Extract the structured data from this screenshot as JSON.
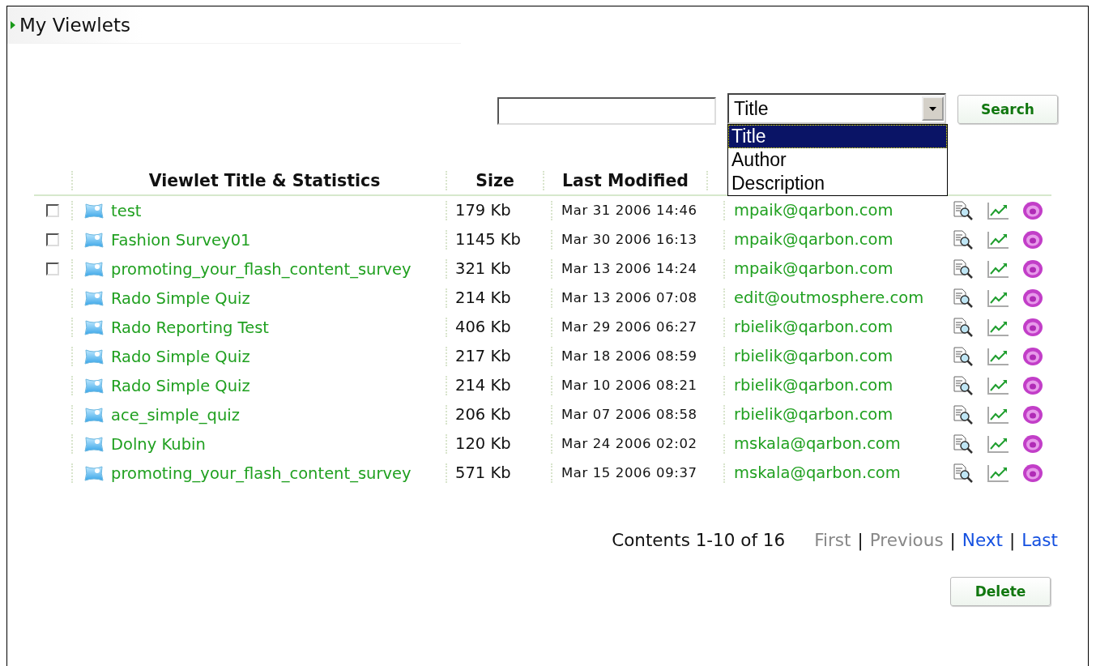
{
  "header": {
    "title": "My Viewlets"
  },
  "search": {
    "field": {
      "value": "Title",
      "open": true,
      "options": [
        {
          "label": "Title",
          "selected": true
        },
        {
          "label": "Author",
          "selected": false
        },
        {
          "label": "Description",
          "selected": false
        }
      ]
    },
    "button": "Search"
  },
  "table": {
    "columns": [
      "Viewlet Title & Statistics",
      "Size",
      "Last Modified"
    ],
    "rows": [
      {
        "has_checkbox": true,
        "checked": false,
        "title": "test",
        "size": "179 Kb",
        "modified": "Mar 31 2006 14:46",
        "author": "mpaik@qarbon.com"
      },
      {
        "has_checkbox": true,
        "checked": false,
        "title": "Fashion Survey01",
        "size": "1145 Kb",
        "modified": "Mar 30 2006 16:13",
        "author": "mpaik@qarbon.com"
      },
      {
        "has_checkbox": true,
        "checked": false,
        "title": "promoting_your_flash_content_survey",
        "size": "321 Kb",
        "modified": "Mar 13 2006 14:24",
        "author": "mpaik@qarbon.com"
      },
      {
        "has_checkbox": false,
        "title": "Rado Simple Quiz",
        "size": "214 Kb",
        "modified": "Mar 13 2006 07:08",
        "author": "edit@outmosphere.com"
      },
      {
        "has_checkbox": false,
        "title": "Rado Reporting Test",
        "size": "406 Kb",
        "modified": "Mar 29 2006 06:27",
        "author": "rbielik@qarbon.com"
      },
      {
        "has_checkbox": false,
        "title": "Rado Simple Quiz",
        "size": "217 Kb",
        "modified": "Mar 18 2006 08:59",
        "author": "rbielik@qarbon.com"
      },
      {
        "has_checkbox": false,
        "title": "Rado Simple Quiz",
        "size": "214 Kb",
        "modified": "Mar 10 2006 08:21",
        "author": "rbielik@qarbon.com"
      },
      {
        "has_checkbox": false,
        "title": "ace_simple_quiz",
        "size": "206 Kb",
        "modified": "Mar 07 2006 08:58",
        "author": "rbielik@qarbon.com"
      },
      {
        "has_checkbox": false,
        "title": "Dolny Kubin",
        "size": "120 Kb",
        "modified": "Mar 24 2006 02:02",
        "author": "mskala@qarbon.com"
      },
      {
        "has_checkbox": false,
        "title": "promoting_your_flash_content_survey",
        "size": "571 Kb",
        "modified": "Mar 15 2006 09:37",
        "author": "mskala@qarbon.com"
      }
    ]
  },
  "pagination": {
    "summary": "Contents 1-10 of 16",
    "links": [
      {
        "kind": "link",
        "label": "First",
        "enabled": false
      },
      {
        "kind": "separator",
        "label": "|"
      },
      {
        "kind": "link",
        "label": "Previous",
        "enabled": false
      },
      {
        "kind": "separator",
        "label": "|"
      },
      {
        "kind": "link",
        "label": "Next",
        "enabled": true
      },
      {
        "kind": "separator",
        "label": "|"
      },
      {
        "kind": "link",
        "label": "Last",
        "enabled": true
      }
    ]
  },
  "delete_button": "Delete"
}
